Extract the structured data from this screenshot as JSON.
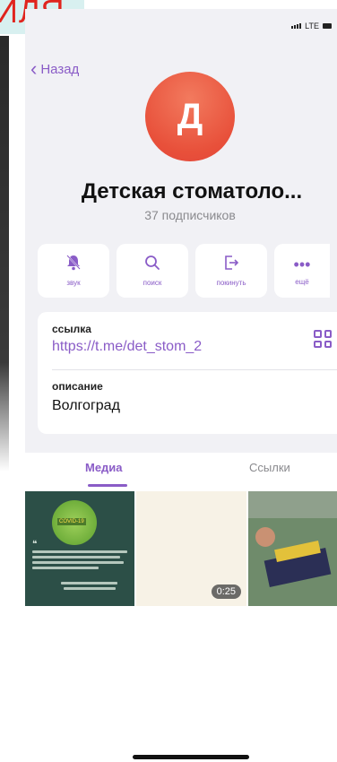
{
  "caption": "ИЛЯ",
  "status_bar": {
    "network": "LTE"
  },
  "nav": {
    "back_label": "Назад"
  },
  "profile": {
    "avatar_letter": "Д",
    "name": "Детская стоматоло...",
    "subscribers": "37 подписчиков"
  },
  "actions": [
    {
      "label": "звук",
      "icon": "bell-slash-icon"
    },
    {
      "label": "поиск",
      "icon": "search-icon"
    },
    {
      "label": "покинуть",
      "icon": "leave-icon"
    },
    {
      "label": "ещё",
      "icon": "more-icon"
    }
  ],
  "info": {
    "link_label": "ссылка",
    "link_value": "https://t.me/det_stom_2",
    "description_label": "описание",
    "description_value": "Волгоград"
  },
  "tabs": [
    {
      "label": "Медиа",
      "active": true
    },
    {
      "label": "Ссылки",
      "active": false
    }
  ],
  "media": {
    "covid_badge": "COVID-19",
    "video_duration": "0:25"
  },
  "colors": {
    "accent": "#8a5cc7",
    "avatar": "#e8503a",
    "background": "#f1f1f5"
  }
}
